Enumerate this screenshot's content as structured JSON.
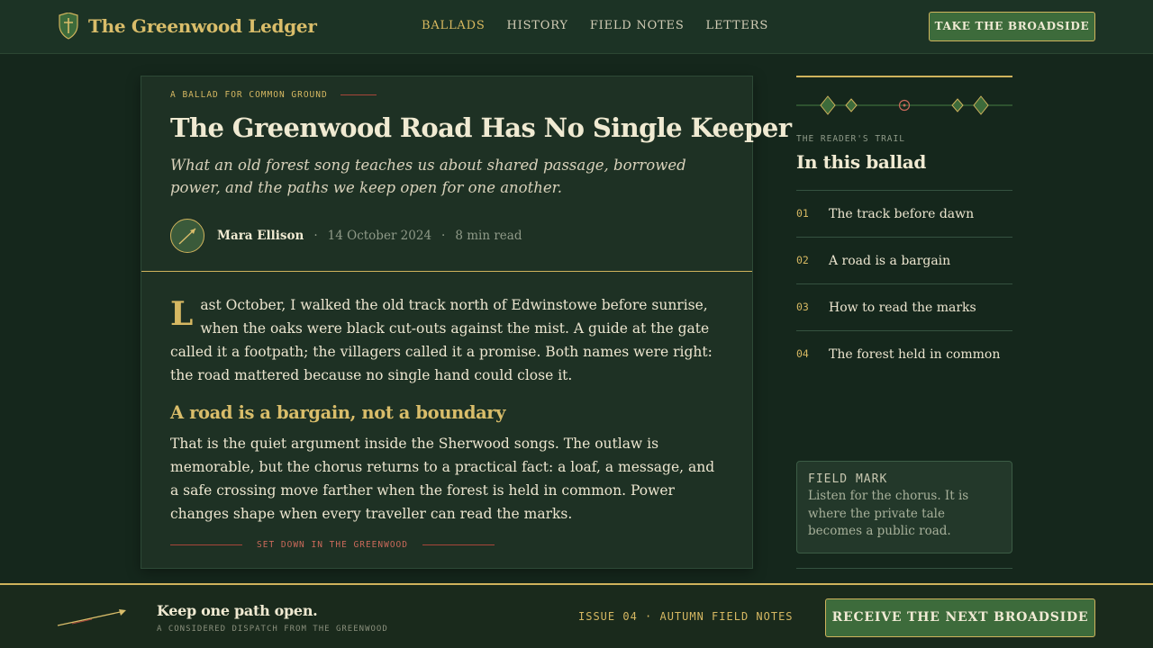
{
  "header": {
    "brand": "The Greenwood Ledger",
    "nav": [
      "BALLADS",
      "HISTORY",
      "FIELD NOTES",
      "LETTERS"
    ],
    "active_nav": "BALLADS",
    "cta": "TAKE THE BROADSIDE"
  },
  "article": {
    "kicker": "A BALLAD FOR COMMON GROUND",
    "title": "The Greenwood Road Has No Single Keeper",
    "dek": "What an old forest song teaches us about shared passage, borrowed power, and the paths we keep open for one another.",
    "author": "Mara Ellison",
    "date": "14 October 2024",
    "read_time": "8 min read",
    "dropcap": "L",
    "p1": "ast October, I walked the old track north of Edwinstowe before sunrise, when the oaks were black cut-outs against the mist. A guide at the gate called it a footpath; the villagers called it a promise. Both names were right: the road mattered because no single hand could close it.",
    "subhead": "A road is a bargain, not a boundary",
    "p2": "That is the quiet argument inside the Sherwood songs. The outlaw is memorable, but the chorus returns to a practical fact: a loaf, a message, and a safe crossing move farther when the forest is held in common. Power changes shape when every traveller can read the marks.",
    "signoff": "SET DOWN IN THE GREENWOOD"
  },
  "sidebar": {
    "kicker": "THE READER'S TRAIL",
    "title": "In this ballad",
    "toc": [
      {
        "num": "01",
        "label": "The track before dawn"
      },
      {
        "num": "02",
        "label": "A road is a bargain"
      },
      {
        "num": "03",
        "label": "How to read the marks"
      },
      {
        "num": "04",
        "label": "The forest held in common"
      }
    ],
    "field_mark": {
      "title": "FIELD MARK",
      "text": "Listen for the chorus. It is where the private tale becomes a public road."
    }
  },
  "footer": {
    "title": "Keep one path open.",
    "subtitle": "A CONSIDERED DISPATCH FROM THE GREENWOOD",
    "issue": "ISSUE 04 · AUTUMN FIELD NOTES",
    "cta": "RECEIVE THE NEXT BROADSIDE"
  },
  "colors": {
    "background": "#15271c",
    "gold": "#cfb35c",
    "accent_green": "#3d6b3b",
    "rust": "#a8463a"
  },
  "icons": {
    "brand": "shield-cross-icon",
    "avatar": "arrow-icon",
    "footer": "arrow-icon",
    "ornament": "diamond-ornament"
  }
}
